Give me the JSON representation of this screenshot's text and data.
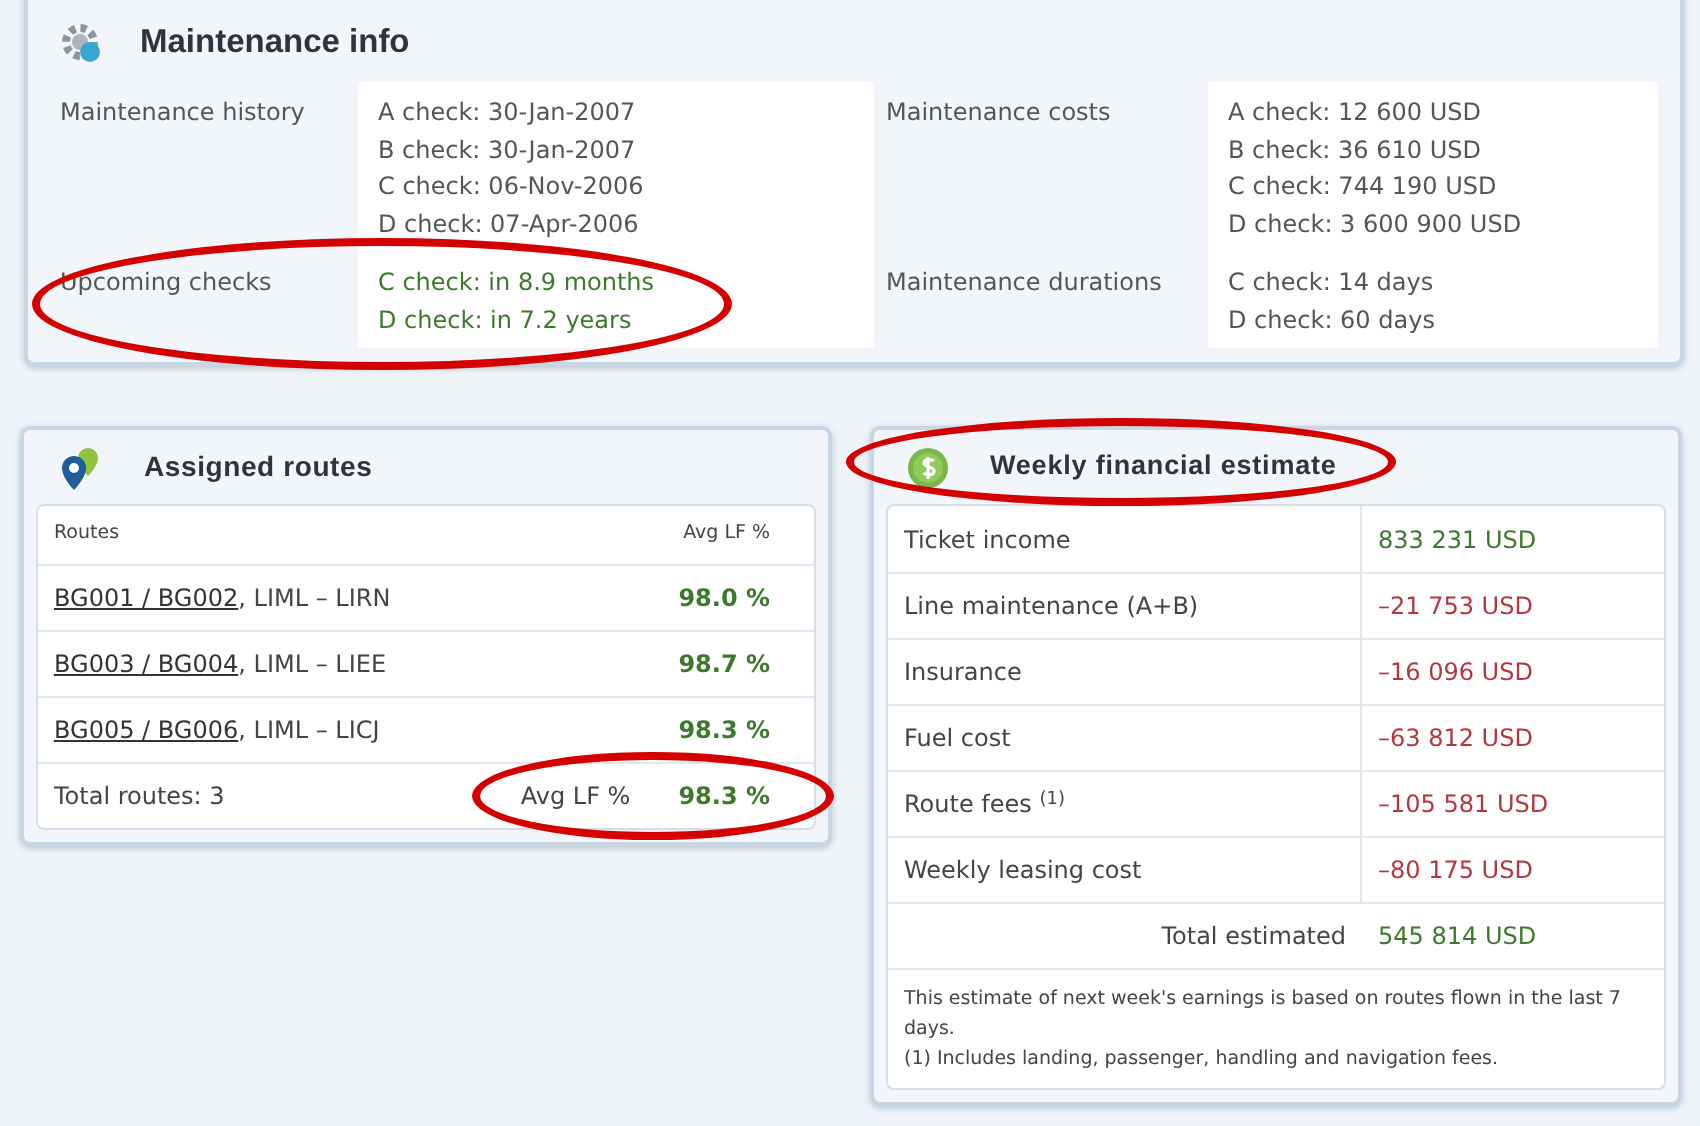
{
  "maintenance": {
    "title": "Maintenance info",
    "items": [
      {
        "label": "Maintenance history",
        "lines": [
          "A check: 30-Jan-2007",
          "B check: 30-Jan-2007",
          "C check: 06-Nov-2006",
          "D check: 07-Apr-2006"
        ],
        "color": "#555555"
      },
      {
        "label": "Maintenance costs",
        "lines": [
          "A check: 12 600 USD",
          "B check: 36 610 USD",
          "C check: 744 190 USD",
          "D check: 3 600 900 USD"
        ],
        "color": "#555555"
      },
      {
        "label": "Upcoming checks",
        "lines": [
          "C check: in 8.9 months",
          "D check: in 7.2 years"
        ],
        "color": "#3b7a2b",
        "circled": true
      },
      {
        "label": "Maintenance durations",
        "lines": [
          "C check: 14 days",
          "D check: 60 days"
        ],
        "color": "#555555"
      }
    ]
  },
  "routes": {
    "title": "Assigned routes",
    "columns": [
      "Routes",
      "Avg LF %"
    ],
    "rows": [
      {
        "flights": "BG001 / BG002",
        "route": ", LIML – LIRN",
        "lf": "98.0 %"
      },
      {
        "flights": "BG003 / BG004",
        "route": ", LIML – LIEE",
        "lf": "98.7 %"
      },
      {
        "flights": "BG005 / BG006",
        "route": ", LIML – LICJ",
        "lf": "98.3 %"
      }
    ],
    "footer": {
      "total": "Total routes: 3",
      "avg_label": "Avg LF %",
      "avg": "98.3 %",
      "circled": true
    }
  },
  "finance": {
    "title": "Weekly financial estimate",
    "title_circled": true,
    "rows": [
      {
        "label": "Ticket income",
        "value": "833 231 USD",
        "color": "#3b7a2b"
      },
      {
        "label": "Line maintenance (A+B)",
        "value": "–21 753 USD",
        "color": "#b5363f"
      },
      {
        "label": "Insurance",
        "value": "–16 096 USD",
        "color": "#b5363f"
      },
      {
        "label": "Fuel cost",
        "value": "–63 812 USD",
        "color": "#b5363f"
      },
      {
        "label": "Route fees $^{(1)}$",
        "value": "–105 581 USD",
        "color": "#b5363f"
      },
      {
        "label": "Weekly leasing cost",
        "value": "–80 175 USD",
        "color": "#b5363f"
      }
    ],
    "total": {
      "label": "Total estimated",
      "value": "545 814 USD",
      "color": "#3b7a2b"
    },
    "notes": [
      "This estimate of next week's earnings is based on routes flown in the last 7 days.",
      "(1) Includes landing, passenger, handling and navigation fees."
    ]
  }
}
